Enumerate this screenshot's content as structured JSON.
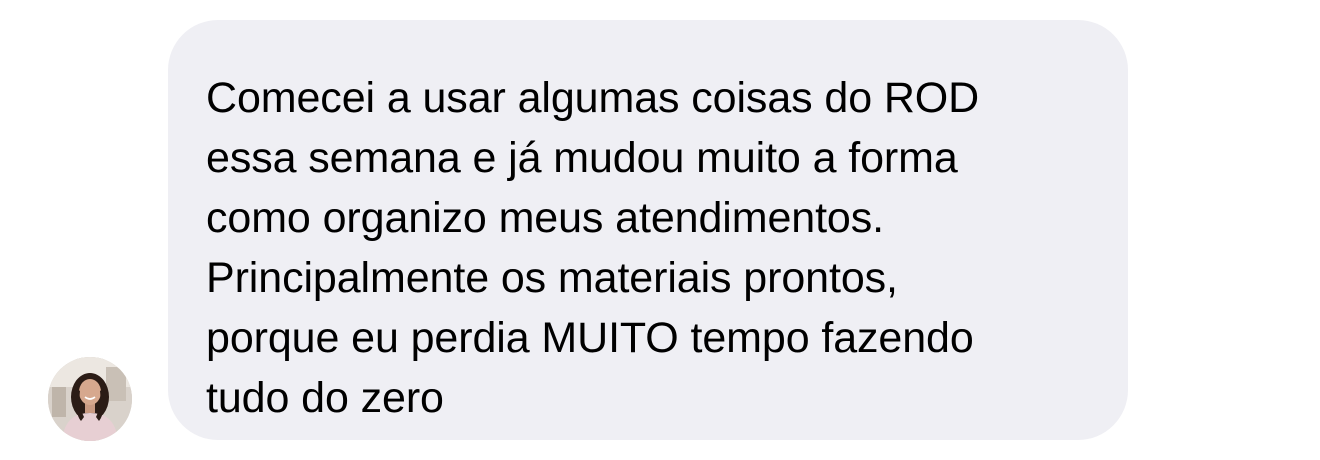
{
  "conversation": {
    "message": {
      "sender_avatar_icon": "profile-photo",
      "text": "Comecei a usar algumas coisas do ROD\nessa semana e já mudou muito a forma\ncomo organizo meus atendimentos.\nPrincipalmente os materiais prontos,\nporque eu perdia MUITO tempo fazendo\ntudo do zero"
    }
  },
  "colors": {
    "page_background": "#ffffff",
    "bubble_background": "#efeff4",
    "text": "#000000"
  }
}
